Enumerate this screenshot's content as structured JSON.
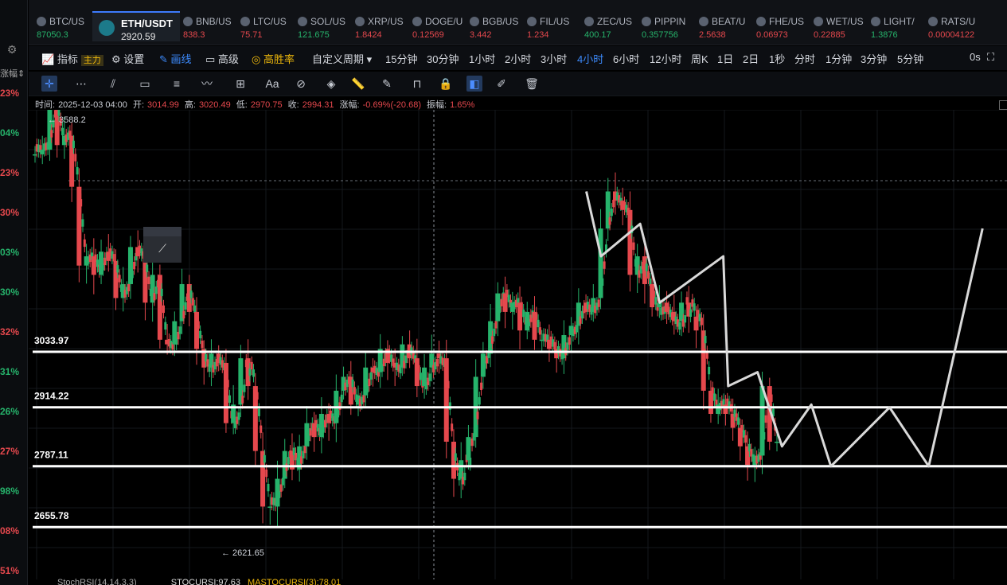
{
  "left_rail": {
    "sort_label": "涨幅",
    "percentages": [
      {
        "text": "23%",
        "color": "#e5484d"
      },
      {
        "text": "04%",
        "color": "#26b36b"
      },
      {
        "text": "23%",
        "color": "#e5484d"
      },
      {
        "text": "30%",
        "color": "#e5484d"
      },
      {
        "text": "03%",
        "color": "#26b36b"
      },
      {
        "text": "30%",
        "color": "#26b36b"
      },
      {
        "text": "32%",
        "color": "#e5484d"
      },
      {
        "text": "31%",
        "color": "#26b36b"
      },
      {
        "text": "26%",
        "color": "#26b36b"
      },
      {
        "text": "27%",
        "color": "#e5484d"
      },
      {
        "text": "98%",
        "color": "#26b36b"
      },
      {
        "text": "08%",
        "color": "#e5484d"
      },
      {
        "text": "51%",
        "color": "#e5484d"
      }
    ]
  },
  "tickers": [
    {
      "symbol": "BTC/US",
      "price": "87050.3",
      "color": "#26b36b"
    },
    {
      "symbol": "ETH/USDT",
      "price": "2920.59",
      "color": "#e6e6e6",
      "active": true
    },
    {
      "symbol": "BNB/US",
      "price": "838.3",
      "color": "#e5484d"
    },
    {
      "symbol": "LTC/US",
      "price": "75.71",
      "color": "#e5484d"
    },
    {
      "symbol": "SOL/US",
      "price": "121.675",
      "color": "#26b36b"
    },
    {
      "symbol": "XRP/US",
      "price": "1.8424",
      "color": "#e5484d"
    },
    {
      "symbol": "DOGE/U",
      "price": "0.12569",
      "color": "#e5484d"
    },
    {
      "symbol": "BGB/US",
      "price": "3.442",
      "color": "#e5484d"
    },
    {
      "symbol": "FIL/US",
      "price": "1.234",
      "color": "#e5484d"
    },
    {
      "symbol": "ZEC/US",
      "price": "400.17",
      "color": "#26b36b"
    },
    {
      "symbol": "PIPPIN",
      "price": "0.357756",
      "color": "#26b36b"
    },
    {
      "symbol": "BEAT/U",
      "price": "2.5638",
      "color": "#e5484d"
    },
    {
      "symbol": "FHE/US",
      "price": "0.06973",
      "color": "#e5484d"
    },
    {
      "symbol": "WET/US",
      "price": "0.22885",
      "color": "#e5484d"
    },
    {
      "symbol": "LIGHT/",
      "price": "1.3876",
      "color": "#26b36b"
    },
    {
      "symbol": "RATS/U",
      "price": "0.00004122",
      "color": "#e5484d"
    }
  ],
  "period_bar": {
    "indicator": "指标",
    "indicator_badge": "主力",
    "settings": "设置",
    "draw": "画线",
    "advanced": "高级",
    "win_rate": "高胜率",
    "custom_period": "自定义周期",
    "periods": [
      "15分钟",
      "30分钟",
      "1小时",
      "2小时",
      "3小时",
      "4小时",
      "6小时",
      "12小时",
      "周K",
      "1日",
      "2日",
      "1秒",
      "分时",
      "1分钟",
      "3分钟",
      "5分钟"
    ],
    "active_period": "4小时",
    "countdown": "0s"
  },
  "draw_tools": [
    "crosshair-tool",
    "dotted-line-tool",
    "parallel-lines-tool",
    "rectangle-tool",
    "horizontal-lines-tool",
    "wave-tool",
    "measure-tool",
    "text-tool",
    "fibonacci-tool",
    "pattern-tool",
    "ruler-tool",
    "brush-tool",
    "magnet-tool",
    "lock-tool",
    "select-tool",
    "edit-tool",
    "delete-tool"
  ],
  "draw_text_label": "Aa",
  "ohlc": {
    "time_label": "时间:",
    "time": "2025-12-03 04:00",
    "open_label": "开:",
    "open": "3014.99",
    "high_label": "高:",
    "high": "3020.49",
    "low_label": "低:",
    "low": "2970.75",
    "close_label": "收:",
    "close": "2994.31",
    "change_label": "涨幅:",
    "change": "-0.69%(-20.68)",
    "amp_label": "振幅:",
    "amp": "1.65%"
  },
  "chart_data": {
    "type": "candlestick",
    "max_label": "← 3588.2",
    "min_label": "← 2621.65",
    "levels": [
      {
        "label": "3033.97",
        "value": 3033.97
      },
      {
        "label": "2914.22",
        "value": 2914.22
      },
      {
        "label": "2787.11",
        "value": 2787.11
      },
      {
        "label": "2655.78",
        "value": 2655.78
      }
    ],
    "close_series": [
      3460,
      3470,
      3560,
      3480,
      3500,
      3390,
      3220,
      3240,
      3200,
      3250,
      3230,
      3150,
      3180,
      3260,
      3240,
      3140,
      3200,
      3060,
      3050,
      3100,
      3180,
      3120,
      3040,
      3000,
      3030,
      3010,
      2880,
      2920,
      3020,
      2960,
      2820,
      2700,
      2700,
      2760,
      2820,
      2780,
      2830,
      2880,
      2850,
      2900,
      2880,
      2950,
      2980,
      2920,
      2940,
      3000,
      2990,
      3040,
      3010,
      3000,
      3050,
      3020,
      2960,
      3000,
      3030,
      3020,
      2840,
      2760,
      2800,
      2850,
      2980,
      3030,
      3100,
      3160,
      3120,
      3140,
      3080,
      3120,
      3060,
      3060,
      3040,
      3020,
      3070,
      3090,
      3140,
      3120,
      3150,
      3300,
      3380,
      3360,
      3340,
      3200,
      3240,
      3180,
      3130,
      3140,
      3120,
      3100,
      3140,
      3110,
      3080,
      2950,
      2900,
      2920,
      2900,
      2870,
      2830,
      2790,
      2810,
      2960,
      2840,
      2840
    ],
    "projection_path": [
      [
        0.57,
        3380
      ],
      [
        0.585,
        3240
      ],
      [
        0.625,
        3310
      ],
      [
        0.645,
        3140
      ],
      [
        0.71,
        3240
      ],
      [
        0.715,
        2960
      ],
      [
        0.745,
        2990
      ],
      [
        0.77,
        2830
      ],
      [
        0.8,
        2920
      ],
      [
        0.82,
        2787
      ],
      [
        0.88,
        2914
      ],
      [
        0.92,
        2787
      ],
      [
        0.975,
        3300
      ]
    ]
  },
  "indicator_row": {
    "stoch": "StochRSI(14,14,3,3)",
    "stocurs": "STOCURSI:97.63",
    "mastocursi": "MASTOCURSI(3):78.01"
  }
}
